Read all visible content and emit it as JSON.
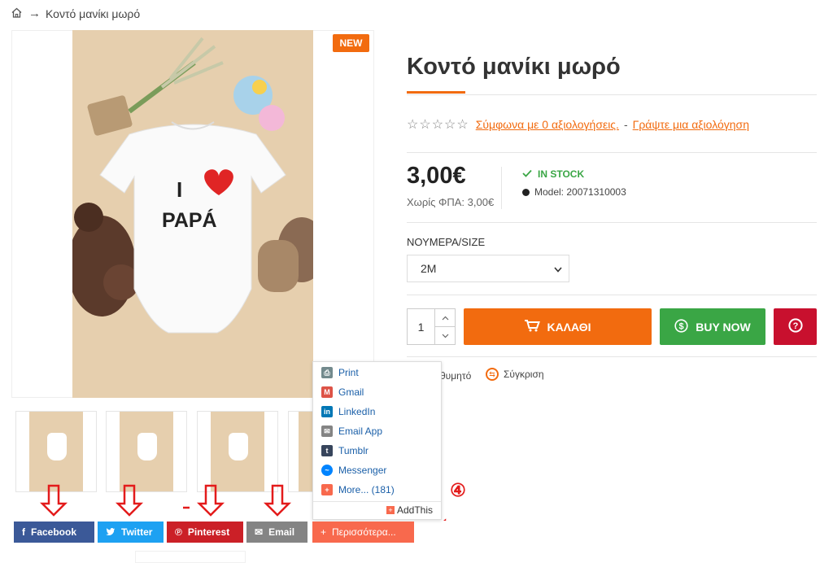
{
  "breadcrumb": {
    "home_icon": "home-icon",
    "separator": "→",
    "current": "Κοντό μανίκι μωρό"
  },
  "product": {
    "badge": "NEW",
    "title": "Κοντό μανίκι μωρό",
    "shirt_text_i": "I",
    "shirt_text_papa": "PAPÁ",
    "stars": "☆☆☆☆☆",
    "reviews_link": "Σύμφωνα με 0 αξιολογήσεις.",
    "review_separator": "-",
    "write_review_link": "Γράψτε μια αξιολόγηση",
    "price": "3,00€",
    "price_ex_tax": "Χωρίς ΦΠΑ: 3,00€",
    "stock_status": "IN STOCK",
    "model": "Model: 20071310003",
    "option_label": "ΝΟΥΜΕΡΑ/SIZE",
    "option_selected": "2M",
    "quantity": "1",
    "cart_button": "ΚΑΛΑΘΙ",
    "buy_now_button": "BUY NOW",
    "help_button_icon": "question-icon",
    "wishlist_text": "θυμητό",
    "compare_text": "Σύγκριση"
  },
  "addthis_menu": {
    "items": [
      {
        "label": "Print",
        "icon": "print-icon",
        "color": "#738a8d"
      },
      {
        "label": "Gmail",
        "icon": "gmail-icon",
        "color": "#dd5347"
      },
      {
        "label": "LinkedIn",
        "icon": "linkedin-icon",
        "color": "#0077b5"
      },
      {
        "label": "Email App",
        "icon": "email-app-icon",
        "color": "#848484"
      },
      {
        "label": "Tumblr",
        "icon": "tumblr-icon",
        "color": "#37455c"
      },
      {
        "label": "Messenger",
        "icon": "messenger-icon",
        "color": "#0084ff"
      },
      {
        "label": "More... (181)",
        "icon": "more-icon",
        "color": "#f8694d"
      }
    ],
    "footer": "AddThis"
  },
  "annotation": {
    "number": "④"
  },
  "share_buttons": {
    "facebook": "Facebook",
    "twitter": "Twitter",
    "pinterest": "Pinterest",
    "email": "Email",
    "more": "Περισσότερα..."
  },
  "colors": {
    "accent": "#f26b0f",
    "green": "#3aa645",
    "red": "#c8102e",
    "annotation": "#e31b1b"
  }
}
